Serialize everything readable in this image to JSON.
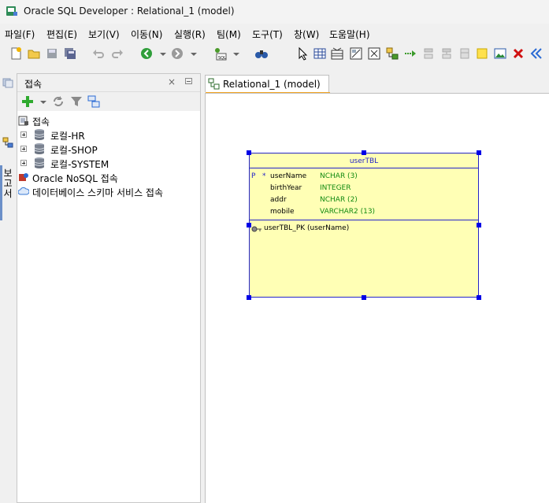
{
  "window": {
    "title": "Oracle SQL Developer : Relational_1 (model)"
  },
  "menu": [
    "파일(F)",
    "편집(E)",
    "보기(V)",
    "이동(N)",
    "실행(R)",
    "팀(M)",
    "도구(T)",
    "창(W)",
    "도움말(H)"
  ],
  "toolbar_icons": [
    "new-icon",
    "open-icon",
    "save-icon",
    "save-all-icon",
    "undo-icon",
    "redo-icon",
    "back-icon",
    "forward-icon",
    "sql-worksheet-icon",
    "binoculars-icon",
    "select-pointer-icon",
    "new-table-icon",
    "new-view-icon",
    "split-table-icon",
    "merge-tables-icon",
    "new-fk-icon",
    "new-arrow-icon",
    "align-icon-1",
    "align-icon-2",
    "align-icon-3",
    "note-icon",
    "picture-icon",
    "delete-icon",
    "collapse-icon"
  ],
  "sidebar": {
    "vertical_label": "보고서"
  },
  "connections_panel": {
    "title": "접속",
    "close_glyph": "×",
    "tree": {
      "root": "접속",
      "items": [
        "로컬-HR",
        "로컬-SHOP",
        "로컬-SYSTEM"
      ],
      "nosql": "Oracle NoSQL 접속",
      "schema_service": "데이터베이스 스키마 서비스 접속"
    }
  },
  "editor": {
    "tab_label": "Relational_1 (model)",
    "entity": {
      "name": "userTBL",
      "columns": [
        {
          "pk": "P",
          "req": "*",
          "name": "userName",
          "type": "NCHAR (3)"
        },
        {
          "pk": "",
          "req": "",
          "name": "birthYear",
          "type": "INTEGER"
        },
        {
          "pk": "",
          "req": "",
          "name": "addr",
          "type": "NCHAR (2)"
        },
        {
          "pk": "",
          "req": "",
          "name": "mobile",
          "type": "VARCHAR2 (13)"
        }
      ],
      "key": "userTBL_PK (userName)"
    }
  },
  "colors": {
    "entity_fill": "#ffffb5",
    "entity_border": "#2424c8",
    "type_text": "#118a11",
    "tab_accent": "#f5a623"
  }
}
